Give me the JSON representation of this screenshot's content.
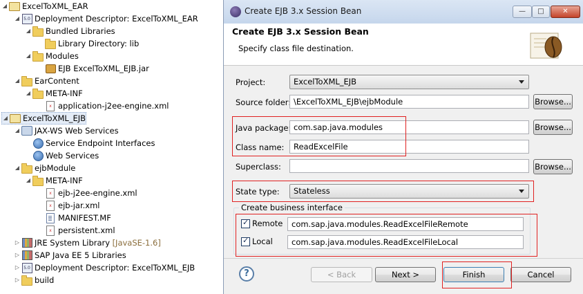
{
  "tree": {
    "items": [
      {
        "label": "ExcelToXML_EAR",
        "icon": "ear-project-icon"
      },
      {
        "label": "Deployment Descriptor: ExcelToXML_EAR",
        "icon": "deployment-descriptor-icon"
      },
      {
        "label": "Bundled Libraries",
        "icon": "folder-icon"
      },
      {
        "label": "Library Directory: lib",
        "icon": "folder-icon"
      },
      {
        "label": "Modules",
        "icon": "folder-icon"
      },
      {
        "label": "EJB ExcelToXML_EJB.jar",
        "icon": "jar-icon"
      },
      {
        "label": "EarContent",
        "icon": "folder-icon"
      },
      {
        "label": "META-INF",
        "icon": "folder-icon"
      },
      {
        "label": "application-j2ee-engine.xml",
        "icon": "xml-file-icon"
      },
      {
        "label": "ExcelToXML_EJB",
        "icon": "ejb-project-icon"
      },
      {
        "label": "JAX-WS Web Services",
        "icon": "jaxws-icon"
      },
      {
        "label": "Service Endpoint Interfaces",
        "icon": "web-service-icon"
      },
      {
        "label": "Web Services",
        "icon": "web-service-icon"
      },
      {
        "label": "ejbModule",
        "icon": "source-folder-icon"
      },
      {
        "label": "META-INF",
        "icon": "folder-icon"
      },
      {
        "label": "ejb-j2ee-engine.xml",
        "icon": "xml-file-icon"
      },
      {
        "label": "ejb-jar.xml",
        "icon": "xml-file-icon"
      },
      {
        "label": "MANIFEST.MF",
        "icon": "file-icon"
      },
      {
        "label": "persistent.xml",
        "icon": "xml-file-icon"
      },
      {
        "label": "JRE System Library",
        "suffix": "[JavaSE-1.6]",
        "icon": "library-icon"
      },
      {
        "label": "SAP Java EE 5 Libraries",
        "icon": "library-icon"
      },
      {
        "label": "Deployment Descriptor: ExcelToXML_EJB",
        "icon": "deployment-descriptor-icon"
      },
      {
        "label": "build",
        "icon": "folder-icon"
      }
    ]
  },
  "dialog": {
    "title": "Create EJB 3.x Session Bean",
    "header_title": "Create EJB 3.x Session Bean",
    "header_subtitle": "Specify class file destination.",
    "window_buttons": {
      "minimize": "—",
      "maximize": "□",
      "close": "✕"
    },
    "form": {
      "project_label": "Project:",
      "project_value": "ExcelToXML_EJB",
      "source_folder_label": "Source folder:",
      "source_folder_value": "\\ExcelToXML_EJB\\ejbModule",
      "java_package_label": "Java package:",
      "java_package_value": "com.sap.java.modules",
      "class_name_label": "Class name:",
      "class_name_value": "ReadExcelFile",
      "superclass_label": "Superclass:",
      "superclass_value": "",
      "state_type_label": "State type:",
      "state_type_value": "Stateless",
      "browse_label": "Browse..."
    },
    "business_interface": {
      "group_title": "Create business interface",
      "remote_label": "Remote",
      "remote_checked": true,
      "remote_value": "com.sap.java.modules.ReadExcelFileRemote",
      "local_label": "Local",
      "local_checked": true,
      "local_value": "com.sap.java.modules.ReadExcelFileLocal"
    },
    "footer": {
      "help": "?",
      "back": "< Back",
      "next": "Next >",
      "finish": "Finish",
      "cancel": "Cancel"
    },
    "highlight_color": "#e02020"
  }
}
